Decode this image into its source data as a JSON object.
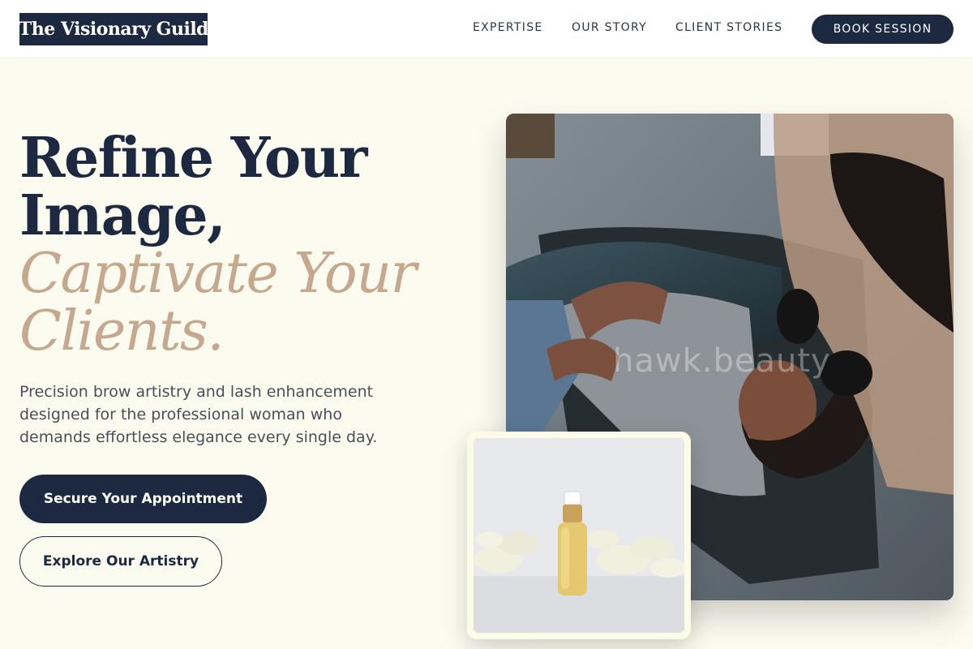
{
  "brand": {
    "name": "The Visionary Guild"
  },
  "nav": {
    "items": [
      "EXPERTISE",
      "OUR STORY",
      "CLIENT STORIES"
    ],
    "cta": "BOOK SESSION"
  },
  "hero": {
    "headline_line1": "Refine Your",
    "headline_line2": "Image,",
    "accent_line1": "Captivate Your",
    "accent_line2": "Clients.",
    "subtext": "Precision brow artistry and lash enhancement designed for the professional woman who demands effortless elegance every single day.",
    "primary_cta": "Secure Your Appointment",
    "secondary_cta": "Explore Our Artistry"
  },
  "media": {
    "main_watermark": "hawk.beauty"
  },
  "colors": {
    "navy": "#1c2941",
    "accent_tan": "#c6a88e",
    "background": "#fbfbf0"
  }
}
